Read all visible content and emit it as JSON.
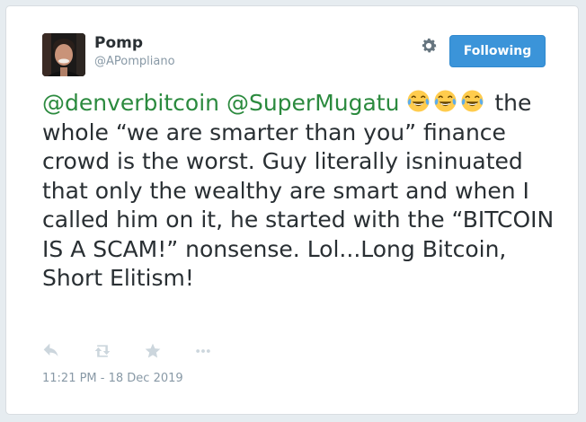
{
  "user": {
    "name": "Pomp",
    "handle": "@APompliano",
    "avatar_icon": "avatar-photo"
  },
  "header": {
    "settings_icon": "gear-icon",
    "follow_button_label": "Following",
    "follow_button_color": "#3b94d9"
  },
  "tweet": {
    "mention_1": "@denverbitcoin",
    "mention_2": "@SuperMugatu",
    "emoji_icon": "face-with-tears-of-joy-emoji",
    "emoji_count": 3,
    "body": "the whole “we are smarter than you” finance crowd is the worst. Guy literally isninuated that only the wealthy are smart and when I called him on it, he started with the “BITCOIN IS A SCAM!” nonsense. Lol...Long Bitcoin, Short Elitism!",
    "mention_color": "#2b8a3e"
  },
  "actions": {
    "icons": [
      "reply-icon",
      "retweet-icon",
      "favorite-star-icon",
      "more-dots-icon"
    ]
  },
  "timestamp": "11:21 PM - 18 Dec 2019"
}
